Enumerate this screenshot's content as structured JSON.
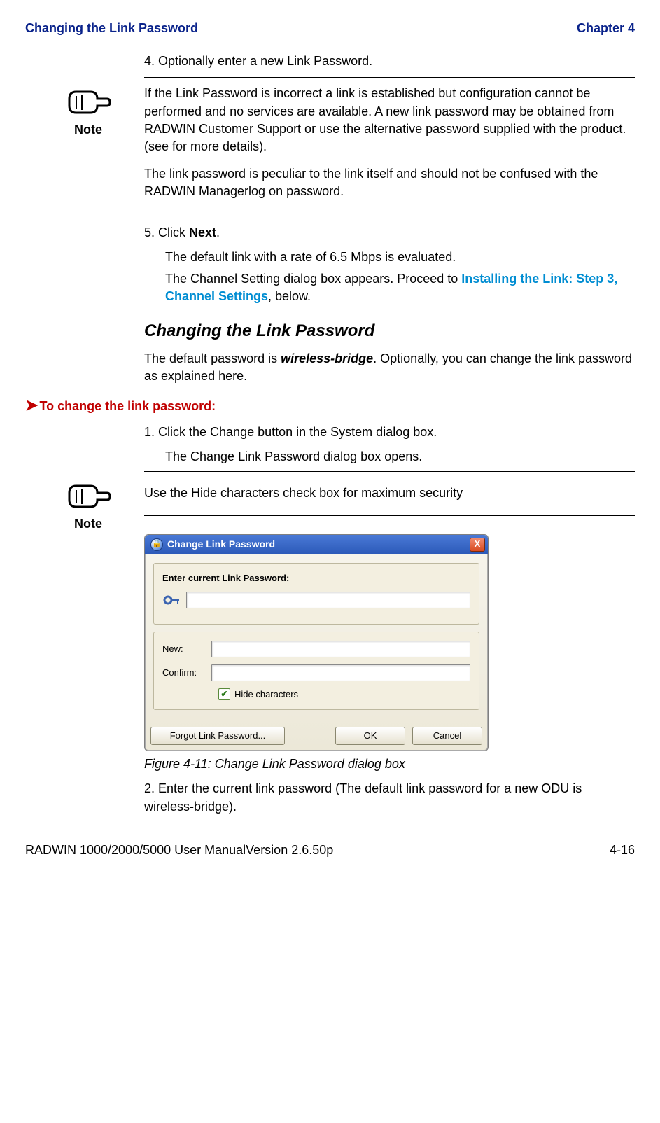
{
  "header": {
    "left": "Changing the Link Password",
    "right": "Chapter 4"
  },
  "step4": "4. Optionally enter a new Link Password.",
  "note1": {
    "label": "Note",
    "p1": "If the Link Password is incorrect a link is established but configuration cannot be performed and no services are available. A new link password may be obtained from RADWIN Customer Support or use the alternative password supplied with the product. (see  for more details).",
    "p2": "The link password is peculiar to the link itself and should not be confused with the RADWIN Managerlog on password."
  },
  "step5": {
    "line": "5. Click ",
    "bold": "Next",
    "dot": ".",
    "p1": "The default link with a rate of 6.5 Mbps is evaluated.",
    "p2a": "The Channel Setting dialog box appears. Proceed to ",
    "link": "Installing the Link: Step 3, Channel Settings",
    "p2b": ", below."
  },
  "sectionTitle": "Changing the Link Password",
  "sectionPara": {
    "a": "The default password is ",
    "b": "wireless-bridge",
    "c": ". Optionally, you can change the link password as explained here."
  },
  "task": "To change the link password:",
  "step1": "1. Click the Change button in the System dialog box.",
  "step1p": "The Change Link Password dialog box opens.",
  "note2": {
    "label": "Note",
    "text": "Use the Hide characters check box for maximum security"
  },
  "dialog": {
    "title": "Change Link Password",
    "close": "X",
    "group1Label": "Enter current Link Password:",
    "new": "New:",
    "confirm": "Confirm:",
    "hide": "Hide characters",
    "forgot": "Forgot Link Password...",
    "ok": "OK",
    "cancel": "Cancel"
  },
  "figureCaption": "Figure 4-11: Change Link Password dialog box",
  "step2": "2. Enter the current link password (The default link password for a new ODU is wireless-bridge).",
  "footer": {
    "left": "RADWIN 1000/2000/5000 User ManualVersion  2.6.50p",
    "right": "4-16"
  }
}
